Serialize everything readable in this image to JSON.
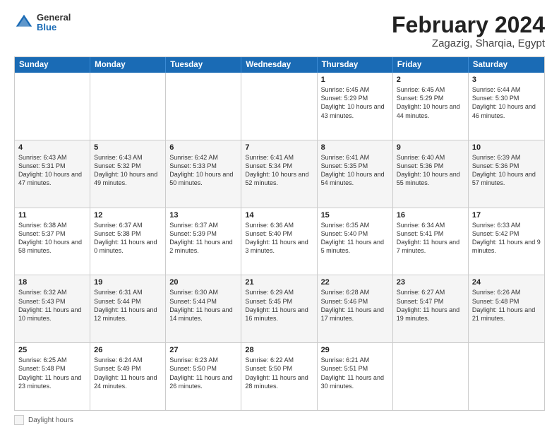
{
  "header": {
    "logo": {
      "general": "General",
      "blue": "Blue"
    },
    "title": "February 2024",
    "subtitle": "Zagazig, Sharqia, Egypt"
  },
  "calendar": {
    "days": [
      "Sunday",
      "Monday",
      "Tuesday",
      "Wednesday",
      "Thursday",
      "Friday",
      "Saturday"
    ],
    "rows": [
      [
        {
          "day": "",
          "sunrise": "",
          "sunset": "",
          "daylight": ""
        },
        {
          "day": "",
          "sunrise": "",
          "sunset": "",
          "daylight": ""
        },
        {
          "day": "",
          "sunrise": "",
          "sunset": "",
          "daylight": ""
        },
        {
          "day": "",
          "sunrise": "",
          "sunset": "",
          "daylight": ""
        },
        {
          "day": "1",
          "sunrise": "Sunrise: 6:45 AM",
          "sunset": "Sunset: 5:29 PM",
          "daylight": "Daylight: 10 hours and 43 minutes."
        },
        {
          "day": "2",
          "sunrise": "Sunrise: 6:45 AM",
          "sunset": "Sunset: 5:29 PM",
          "daylight": "Daylight: 10 hours and 44 minutes."
        },
        {
          "day": "3",
          "sunrise": "Sunrise: 6:44 AM",
          "sunset": "Sunset: 5:30 PM",
          "daylight": "Daylight: 10 hours and 46 minutes."
        }
      ],
      [
        {
          "day": "4",
          "sunrise": "Sunrise: 6:43 AM",
          "sunset": "Sunset: 5:31 PM",
          "daylight": "Daylight: 10 hours and 47 minutes."
        },
        {
          "day": "5",
          "sunrise": "Sunrise: 6:43 AM",
          "sunset": "Sunset: 5:32 PM",
          "daylight": "Daylight: 10 hours and 49 minutes."
        },
        {
          "day": "6",
          "sunrise": "Sunrise: 6:42 AM",
          "sunset": "Sunset: 5:33 PM",
          "daylight": "Daylight: 10 hours and 50 minutes."
        },
        {
          "day": "7",
          "sunrise": "Sunrise: 6:41 AM",
          "sunset": "Sunset: 5:34 PM",
          "daylight": "Daylight: 10 hours and 52 minutes."
        },
        {
          "day": "8",
          "sunrise": "Sunrise: 6:41 AM",
          "sunset": "Sunset: 5:35 PM",
          "daylight": "Daylight: 10 hours and 54 minutes."
        },
        {
          "day": "9",
          "sunrise": "Sunrise: 6:40 AM",
          "sunset": "Sunset: 5:36 PM",
          "daylight": "Daylight: 10 hours and 55 minutes."
        },
        {
          "day": "10",
          "sunrise": "Sunrise: 6:39 AM",
          "sunset": "Sunset: 5:36 PM",
          "daylight": "Daylight: 10 hours and 57 minutes."
        }
      ],
      [
        {
          "day": "11",
          "sunrise": "Sunrise: 6:38 AM",
          "sunset": "Sunset: 5:37 PM",
          "daylight": "Daylight: 10 hours and 58 minutes."
        },
        {
          "day": "12",
          "sunrise": "Sunrise: 6:37 AM",
          "sunset": "Sunset: 5:38 PM",
          "daylight": "Daylight: 11 hours and 0 minutes."
        },
        {
          "day": "13",
          "sunrise": "Sunrise: 6:37 AM",
          "sunset": "Sunset: 5:39 PM",
          "daylight": "Daylight: 11 hours and 2 minutes."
        },
        {
          "day": "14",
          "sunrise": "Sunrise: 6:36 AM",
          "sunset": "Sunset: 5:40 PM",
          "daylight": "Daylight: 11 hours and 3 minutes."
        },
        {
          "day": "15",
          "sunrise": "Sunrise: 6:35 AM",
          "sunset": "Sunset: 5:40 PM",
          "daylight": "Daylight: 11 hours and 5 minutes."
        },
        {
          "day": "16",
          "sunrise": "Sunrise: 6:34 AM",
          "sunset": "Sunset: 5:41 PM",
          "daylight": "Daylight: 11 hours and 7 minutes."
        },
        {
          "day": "17",
          "sunrise": "Sunrise: 6:33 AM",
          "sunset": "Sunset: 5:42 PM",
          "daylight": "Daylight: 11 hours and 9 minutes."
        }
      ],
      [
        {
          "day": "18",
          "sunrise": "Sunrise: 6:32 AM",
          "sunset": "Sunset: 5:43 PM",
          "daylight": "Daylight: 11 hours and 10 minutes."
        },
        {
          "day": "19",
          "sunrise": "Sunrise: 6:31 AM",
          "sunset": "Sunset: 5:44 PM",
          "daylight": "Daylight: 11 hours and 12 minutes."
        },
        {
          "day": "20",
          "sunrise": "Sunrise: 6:30 AM",
          "sunset": "Sunset: 5:44 PM",
          "daylight": "Daylight: 11 hours and 14 minutes."
        },
        {
          "day": "21",
          "sunrise": "Sunrise: 6:29 AM",
          "sunset": "Sunset: 5:45 PM",
          "daylight": "Daylight: 11 hours and 16 minutes."
        },
        {
          "day": "22",
          "sunrise": "Sunrise: 6:28 AM",
          "sunset": "Sunset: 5:46 PM",
          "daylight": "Daylight: 11 hours and 17 minutes."
        },
        {
          "day": "23",
          "sunrise": "Sunrise: 6:27 AM",
          "sunset": "Sunset: 5:47 PM",
          "daylight": "Daylight: 11 hours and 19 minutes."
        },
        {
          "day": "24",
          "sunrise": "Sunrise: 6:26 AM",
          "sunset": "Sunset: 5:48 PM",
          "daylight": "Daylight: 11 hours and 21 minutes."
        }
      ],
      [
        {
          "day": "25",
          "sunrise": "Sunrise: 6:25 AM",
          "sunset": "Sunset: 5:48 PM",
          "daylight": "Daylight: 11 hours and 23 minutes."
        },
        {
          "day": "26",
          "sunrise": "Sunrise: 6:24 AM",
          "sunset": "Sunset: 5:49 PM",
          "daylight": "Daylight: 11 hours and 24 minutes."
        },
        {
          "day": "27",
          "sunrise": "Sunrise: 6:23 AM",
          "sunset": "Sunset: 5:50 PM",
          "daylight": "Daylight: 11 hours and 26 minutes."
        },
        {
          "day": "28",
          "sunrise": "Sunrise: 6:22 AM",
          "sunset": "Sunset: 5:50 PM",
          "daylight": "Daylight: 11 hours and 28 minutes."
        },
        {
          "day": "29",
          "sunrise": "Sunrise: 6:21 AM",
          "sunset": "Sunset: 5:51 PM",
          "daylight": "Daylight: 11 hours and 30 minutes."
        },
        {
          "day": "",
          "sunrise": "",
          "sunset": "",
          "daylight": ""
        },
        {
          "day": "",
          "sunrise": "",
          "sunset": "",
          "daylight": ""
        }
      ]
    ]
  },
  "legend": {
    "label": "Daylight hours"
  }
}
